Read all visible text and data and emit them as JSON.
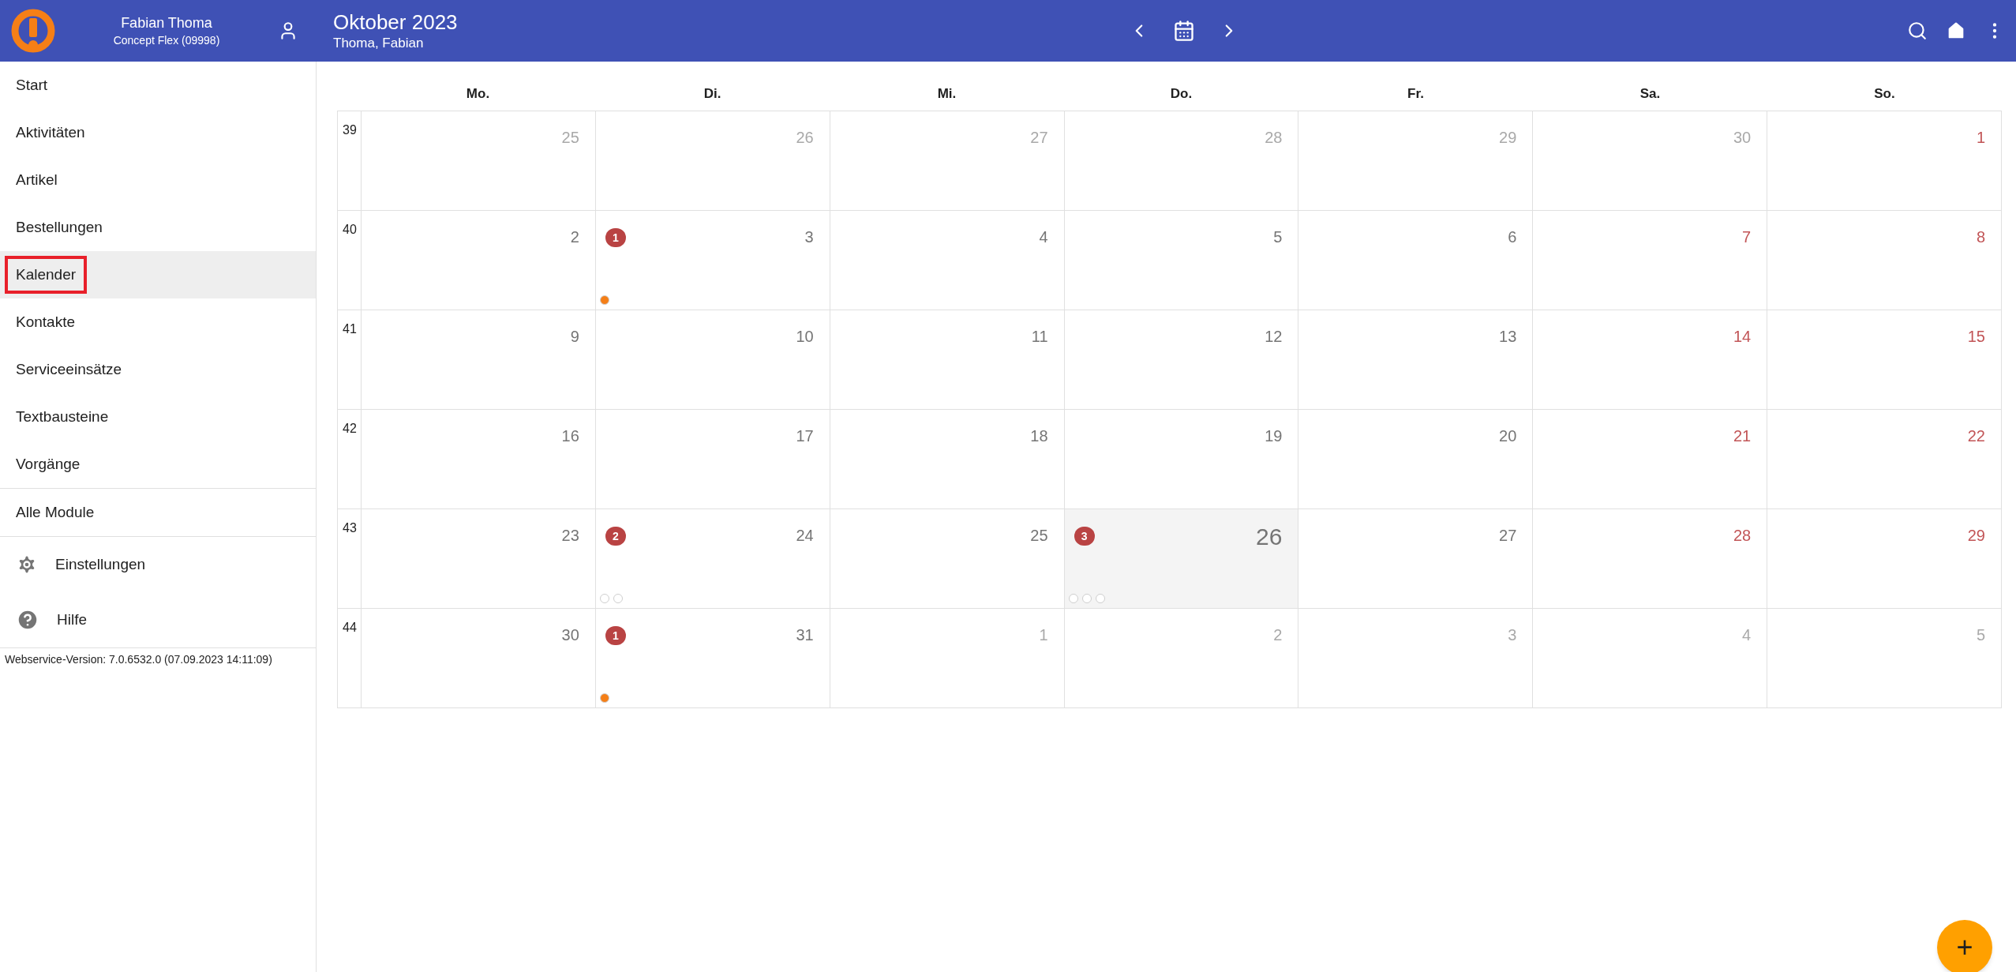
{
  "header": {
    "user_name": "Fabian Thoma",
    "company": "Concept Flex (09998)",
    "title": "Oktober 2023",
    "subtitle": "Thoma, Fabian"
  },
  "sidebar": {
    "items": [
      {
        "label": "Start",
        "selected": false,
        "outlined": false
      },
      {
        "label": "Aktivitäten",
        "selected": false,
        "outlined": false
      },
      {
        "label": "Artikel",
        "selected": false,
        "outlined": false
      },
      {
        "label": "Bestellungen",
        "selected": false,
        "outlined": false
      },
      {
        "label": "Kalender",
        "selected": true,
        "outlined": true
      },
      {
        "label": "Kontakte",
        "selected": false,
        "outlined": false
      },
      {
        "label": "Serviceeinsätze",
        "selected": false,
        "outlined": false
      },
      {
        "label": "Textbausteine",
        "selected": false,
        "outlined": false
      },
      {
        "label": "Vorgänge",
        "selected": false,
        "outlined": false
      }
    ],
    "all_modules": "Alle Module",
    "extras": [
      {
        "kind": "settings",
        "label": "Einstellungen"
      },
      {
        "kind": "help",
        "label": "Hilfe"
      }
    ],
    "version": "Webservice-Version: 7.0.6532.0 (07.09.2023 14:11:09)"
  },
  "calendar": {
    "weekdays": [
      {
        "label": "Mo.",
        "weekend": false
      },
      {
        "label": "Di.",
        "weekend": false
      },
      {
        "label": "Mi.",
        "weekend": false
      },
      {
        "label": "Do.",
        "weekend": false
      },
      {
        "label": "Fr.",
        "weekend": false
      },
      {
        "label": "Sa.",
        "weekend": true
      },
      {
        "label": "So.",
        "weekend": true
      }
    ],
    "weeks": [
      {
        "number": "39",
        "days": [
          {
            "day": "25",
            "in_month": false
          },
          {
            "day": "26",
            "in_month": false
          },
          {
            "day": "27",
            "in_month": false
          },
          {
            "day": "28",
            "in_month": false
          },
          {
            "day": "29",
            "in_month": false
          },
          {
            "day": "30",
            "in_month": false
          },
          {
            "day": "1",
            "in_month": true
          }
        ]
      },
      {
        "number": "40",
        "days": [
          {
            "day": "2",
            "in_month": true
          },
          {
            "day": "3",
            "in_month": true,
            "badge": "1",
            "dots": [
              {
                "color": "#f57f17"
              }
            ]
          },
          {
            "day": "4",
            "in_month": true
          },
          {
            "day": "5",
            "in_month": true
          },
          {
            "day": "6",
            "in_month": true
          },
          {
            "day": "7",
            "in_month": true
          },
          {
            "day": "8",
            "in_month": true
          }
        ]
      },
      {
        "number": "41",
        "days": [
          {
            "day": "9",
            "in_month": true
          },
          {
            "day": "10",
            "in_month": true
          },
          {
            "day": "11",
            "in_month": true
          },
          {
            "day": "12",
            "in_month": true
          },
          {
            "day": "13",
            "in_month": true
          },
          {
            "day": "14",
            "in_month": true
          },
          {
            "day": "15",
            "in_month": true
          }
        ]
      },
      {
        "number": "42",
        "days": [
          {
            "day": "16",
            "in_month": true
          },
          {
            "day": "17",
            "in_month": true
          },
          {
            "day": "18",
            "in_month": true
          },
          {
            "day": "19",
            "in_month": true
          },
          {
            "day": "20",
            "in_month": true
          },
          {
            "day": "21",
            "in_month": true
          },
          {
            "day": "22",
            "in_month": true
          }
        ]
      },
      {
        "number": "43",
        "days": [
          {
            "day": "23",
            "in_month": true
          },
          {
            "day": "24",
            "in_month": true,
            "badge": "2",
            "dots": [
              {
                "color": "#ffffff"
              },
              {
                "color": "#ffffff"
              }
            ]
          },
          {
            "day": "25",
            "in_month": true
          },
          {
            "day": "26",
            "in_month": true,
            "today": true,
            "badge": "3",
            "dots": [
              {
                "color": "#ffffff"
              },
              {
                "color": "#ffffff"
              },
              {
                "color": "#ffffff"
              }
            ]
          },
          {
            "day": "27",
            "in_month": true
          },
          {
            "day": "28",
            "in_month": true
          },
          {
            "day": "29",
            "in_month": true
          }
        ]
      },
      {
        "number": "44",
        "days": [
          {
            "day": "30",
            "in_month": true
          },
          {
            "day": "31",
            "in_month": true,
            "badge": "1",
            "dots": [
              {
                "color": "#f57f17"
              }
            ]
          },
          {
            "day": "1",
            "in_month": false
          },
          {
            "day": "2",
            "in_month": false
          },
          {
            "day": "3",
            "in_month": false
          },
          {
            "day": "4",
            "in_month": false
          },
          {
            "day": "5",
            "in_month": false
          }
        ]
      }
    ]
  },
  "fab": {
    "label": "+"
  }
}
